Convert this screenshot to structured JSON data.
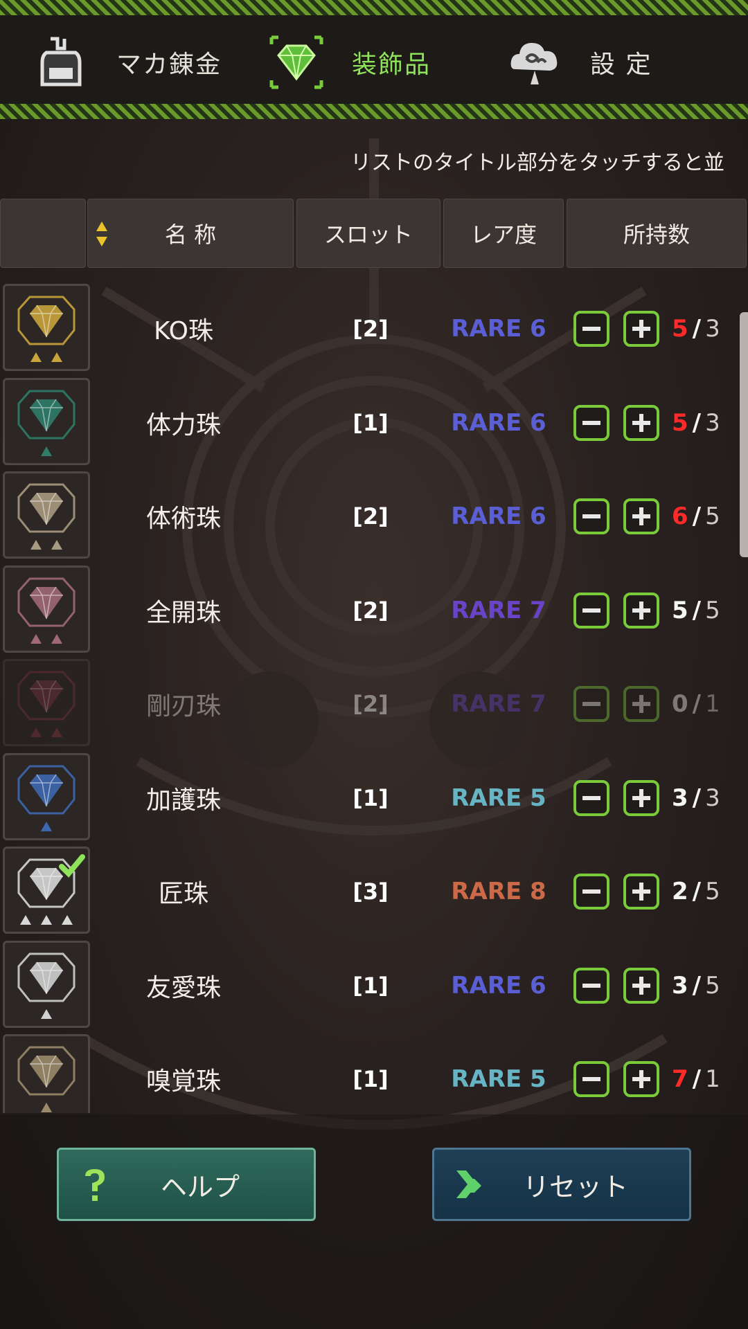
{
  "nav": {
    "items": [
      {
        "label": "マカ錬金",
        "icon": "alchemy-pot-icon"
      },
      {
        "label": "装飾品",
        "icon": "gem-icon"
      },
      {
        "label": "設 定",
        "icon": "cloud-settings-icon"
      }
    ],
    "active": "装飾品"
  },
  "hint": "リストのタイトル部分をタッチすると並",
  "table": {
    "headers": {
      "name": "名 称",
      "slot": "スロット",
      "rarity": "レア度",
      "owned": "所持数"
    }
  },
  "rows": [
    {
      "name": "KO珠",
      "slot": "[2]",
      "rarity": "RARE 6",
      "owned": "5",
      "max": "3",
      "gem_color": "#c9a43c",
      "slots": 2,
      "checked": false,
      "dim": false
    },
    {
      "name": "体力珠",
      "slot": "[1]",
      "rarity": "RARE 6",
      "owned": "5",
      "max": "3",
      "gem_color": "#2f7d6a",
      "slots": 1,
      "checked": false,
      "dim": false
    },
    {
      "name": "体術珠",
      "slot": "[2]",
      "rarity": "RARE 6",
      "owned": "6",
      "max": "5",
      "gem_color": "#a89a80",
      "slots": 2,
      "checked": false,
      "dim": false
    },
    {
      "name": "全開珠",
      "slot": "[2]",
      "rarity": "RARE 7",
      "owned": "5",
      "max": "5",
      "gem_color": "#a06878",
      "slots": 2,
      "checked": false,
      "dim": false
    },
    {
      "name": "剛刃珠",
      "slot": "[2]",
      "rarity": "RARE 7",
      "owned": "0",
      "max": "1",
      "gem_color": "#8a3a46",
      "slots": 2,
      "checked": false,
      "dim": true
    },
    {
      "name": "加護珠",
      "slot": "[1]",
      "rarity": "RARE 5",
      "owned": "3",
      "max": "3",
      "gem_color": "#3d68b0",
      "slots": 1,
      "checked": false,
      "dim": false
    },
    {
      "name": "匠珠",
      "slot": "[3]",
      "rarity": "RARE 8",
      "owned": "2",
      "max": "5",
      "gem_color": "#d8d8d8",
      "slots": 3,
      "checked": true,
      "dim": false
    },
    {
      "name": "友愛珠",
      "slot": "[1]",
      "rarity": "RARE 6",
      "owned": "3",
      "max": "5",
      "gem_color": "#d0d0d0",
      "slots": 1,
      "checked": false,
      "dim": false
    },
    {
      "name": "嗅覚珠",
      "slot": "[1]",
      "rarity": "RARE 5",
      "owned": "7",
      "max": "1",
      "gem_color": "#9a8a6a",
      "slots": 1,
      "checked": false,
      "dim": false
    }
  ],
  "colors": {
    "RARE 5": "#66b4c4",
    "RARE 6": "#5b5fd6",
    "RARE 7": "#6a44c8",
    "RARE 8": "#cc6a48",
    "owned_over": "#ff2a2a",
    "owned_normal": "#f5f5f5",
    "owned_zero": "#f5f5f5",
    "accent": "#7acb3a"
  },
  "buttons": {
    "help": {
      "label": "ヘルプ",
      "icon": "help-question-icon"
    },
    "reset": {
      "label": "リセット",
      "icon": "reset-chevrons-icon"
    }
  }
}
